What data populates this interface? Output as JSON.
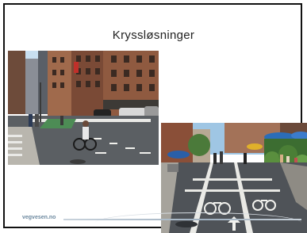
{
  "slide": {
    "title": "Kryssløsninger",
    "footer_brand": "vegvesen.no"
  },
  "images": [
    {
      "name": "street-crossing-photo",
      "subject": "city intersection with cyclist and crosswalk"
    },
    {
      "name": "bike-lane-photo",
      "subject": "street with bike lane markings and pedestrians"
    }
  ]
}
